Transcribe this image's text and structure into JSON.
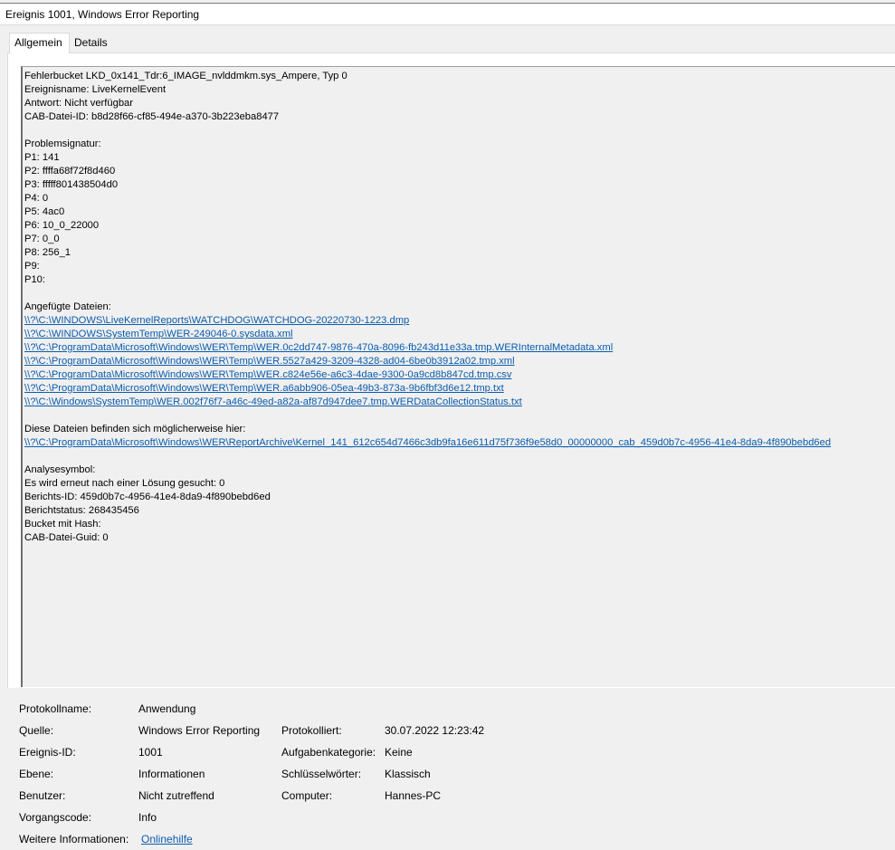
{
  "window": {
    "title": "Ereignis 1001, Windows Error Reporting"
  },
  "tabs": [
    {
      "label": "Allgemein"
    },
    {
      "label": "Details"
    }
  ],
  "description": {
    "header": [
      "Fehlerbucket LKD_0x141_Tdr:6_IMAGE_nvlddmkm.sys_Ampere, Typ 0",
      "Ereignisname: LiveKernelEvent",
      "Antwort: Nicht verfügbar",
      "CAB-Datei-ID: b8d28f66-cf85-494e-a370-3b223eba8477"
    ],
    "signature_title": "Problemsignatur:",
    "signature": [
      "P1: 141",
      "P2: ffffa68f72f8d460",
      "P3: fffff801438504d0",
      "P4: 0",
      "P5: 4ac0",
      "P6: 10_0_22000",
      "P7: 0_0",
      "P8: 256_1",
      "P9:",
      "P10:"
    ],
    "attached_title": "Angefügte Dateien:",
    "attached_files": [
      "\\\\?\\C:\\WINDOWS\\LiveKernelReports\\WATCHDOG\\WATCHDOG-20220730-1223.dmp",
      "\\\\?\\C:\\WINDOWS\\SystemTemp\\WER-249046-0.sysdata.xml",
      "\\\\?\\C:\\ProgramData\\Microsoft\\Windows\\WER\\Temp\\WER.0c2dd747-9876-470a-8096-fb243d11e33a.tmp.WERInternalMetadata.xml",
      "\\\\?\\C:\\ProgramData\\Microsoft\\Windows\\WER\\Temp\\WER.5527a429-3209-4328-ad04-6be0b3912a02.tmp.xml",
      "\\\\?\\C:\\ProgramData\\Microsoft\\Windows\\WER\\Temp\\WER.c824e56e-a6c3-4dae-9300-0a9cd8b847cd.tmp.csv",
      "\\\\?\\C:\\ProgramData\\Microsoft\\Windows\\WER\\Temp\\WER.a6abb906-05ea-49b3-873a-9b6fbf3d6e12.tmp.txt",
      "\\\\?\\C:\\Windows\\SystemTemp\\WER.002f76f7-a46c-49ed-a82a-af87d947dee7.tmp.WERDataCollectionStatus.txt"
    ],
    "location_title": "Diese Dateien befinden sich möglicherweise hier:",
    "location": "\\\\?\\C:\\ProgramData\\Microsoft\\Windows\\WER\\ReportArchive\\Kernel_141_612c654d7466c3db9fa16e611d75f736f9e58d0_00000000_cab_459d0b7c-4956-41e4-8da9-4f890bebd6ed",
    "footer": [
      "Analysesymbol:",
      "Es wird erneut nach einer Lösung gesucht: 0",
      "Berichts-ID: 459d0b7c-4956-41e4-8da9-4f890bebd6ed",
      "Berichtstatus: 268435456",
      "Bucket mit Hash:",
      "CAB-Datei-Guid: 0"
    ]
  },
  "properties": {
    "log_name_label": "Protokollname:",
    "log_name": "Anwendung",
    "source_label": "Quelle:",
    "source": "Windows Error Reporting",
    "logged_label": "Protokolliert:",
    "logged": "30.07.2022 12:23:42",
    "event_id_label": "Ereignis-ID:",
    "event_id": "1001",
    "task_category_label": "Aufgabenkategorie:",
    "task_category": "Keine",
    "level_label": "Ebene:",
    "level": "Informationen",
    "keywords_label": "Schlüsselwörter:",
    "keywords": "Klassisch",
    "user_label": "Benutzer:",
    "user": "Nicht zutreffend",
    "computer_label": "Computer:",
    "computer": "Hannes-PC",
    "opcode_label": "Vorgangscode:",
    "opcode": "Info",
    "more_info_label": "Weitere Informationen:",
    "more_info_link": "Onlinehilfe"
  }
}
